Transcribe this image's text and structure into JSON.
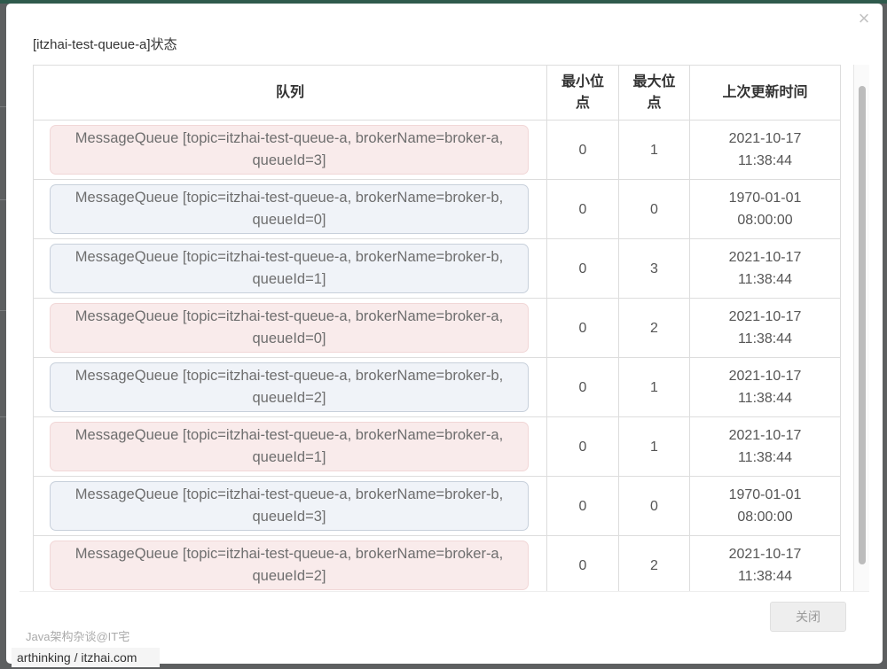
{
  "dialog": {
    "title": "[itzhai-test-queue-a]状态",
    "close_icon": "×",
    "close_button": "关闭"
  },
  "table": {
    "headers": {
      "queue": "队列",
      "min_offset": "最小位点",
      "max_offset": "最大位点",
      "last_update": "上次更新时间"
    },
    "rows": [
      {
        "queue_line1": "MessageQueue [topic=itzhai-test-queue-a, brokerName=broker-a,",
        "queue_line2": "queueId=3]",
        "broker": "a",
        "min": "0",
        "max": "1",
        "date": "2021-10-17",
        "time": "11:38:44"
      },
      {
        "queue_line1": "MessageQueue [topic=itzhai-test-queue-a, brokerName=broker-b,",
        "queue_line2": "queueId=0]",
        "broker": "b",
        "min": "0",
        "max": "0",
        "date": "1970-01-01",
        "time": "08:00:00"
      },
      {
        "queue_line1": "MessageQueue [topic=itzhai-test-queue-a, brokerName=broker-b,",
        "queue_line2": "queueId=1]",
        "broker": "b",
        "min": "0",
        "max": "3",
        "date": "2021-10-17",
        "time": "11:38:44"
      },
      {
        "queue_line1": "MessageQueue [topic=itzhai-test-queue-a, brokerName=broker-a,",
        "queue_line2": "queueId=0]",
        "broker": "a",
        "min": "0",
        "max": "2",
        "date": "2021-10-17",
        "time": "11:38:44"
      },
      {
        "queue_line1": "MessageQueue [topic=itzhai-test-queue-a, brokerName=broker-b,",
        "queue_line2": "queueId=2]",
        "broker": "b",
        "min": "0",
        "max": "1",
        "date": "2021-10-17",
        "time": "11:38:44"
      },
      {
        "queue_line1": "MessageQueue [topic=itzhai-test-queue-a, brokerName=broker-a,",
        "queue_line2": "queueId=1]",
        "broker": "a",
        "min": "0",
        "max": "1",
        "date": "2021-10-17",
        "time": "11:38:44"
      },
      {
        "queue_line1": "MessageQueue [topic=itzhai-test-queue-a, brokerName=broker-b,",
        "queue_line2": "queueId=3]",
        "broker": "b",
        "min": "0",
        "max": "0",
        "date": "1970-01-01",
        "time": "08:00:00"
      },
      {
        "queue_line1": "MessageQueue [topic=itzhai-test-queue-a, brokerName=broker-a,",
        "queue_line2": "queueId=2]",
        "broker": "a",
        "min": "0",
        "max": "2",
        "date": "2021-10-17",
        "time": "11:38:44"
      }
    ]
  },
  "watermark": {
    "line1": "Java架构杂谈@IT宅",
    "line2": "arthinking / itzhai.com"
  },
  "colors": {
    "broker_a_bg": "#f9ebeb",
    "broker_b_bg": "#f0f3f8",
    "topbar": "#2f5a4c"
  }
}
